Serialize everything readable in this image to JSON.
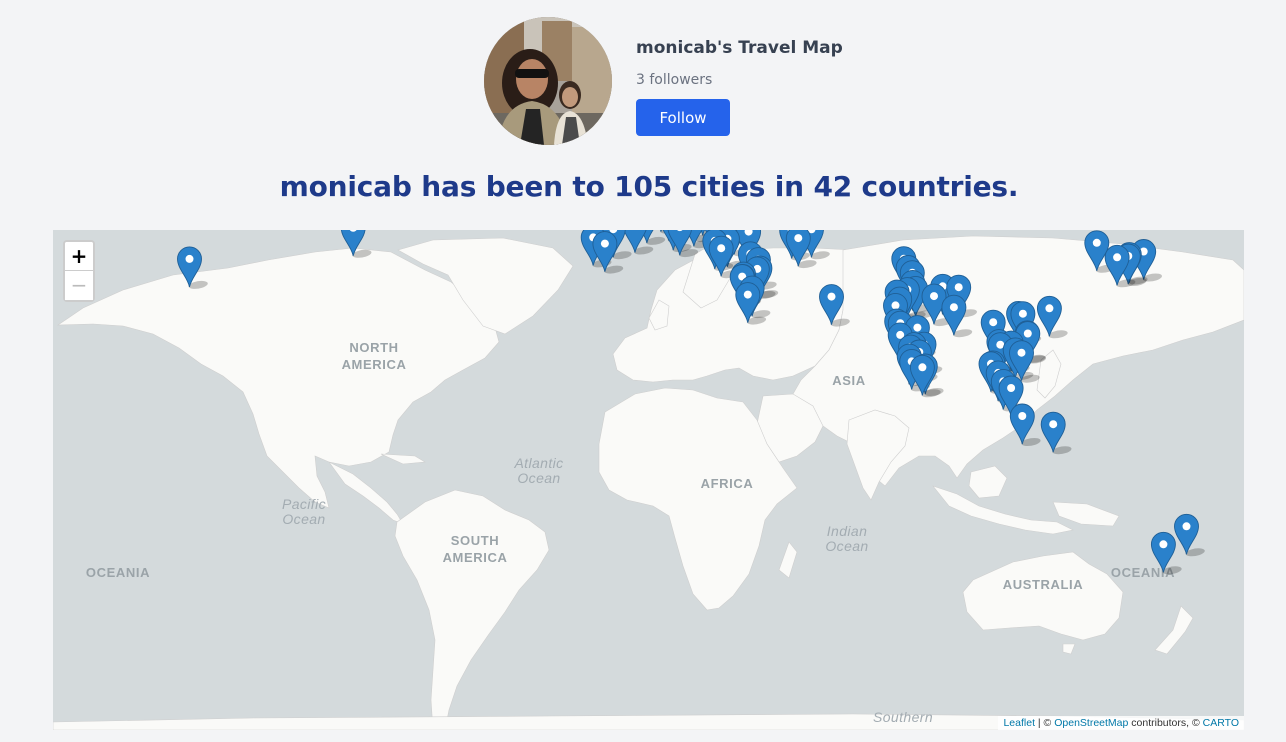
{
  "profile": {
    "title": "monicab's Travel Map",
    "followers": "3 followers",
    "follow_label": "Follow"
  },
  "headline": "monicab has been to 105 cities in 42 countries.",
  "map": {
    "zoom_in": "+",
    "zoom_out": "−",
    "labels": {
      "north_america": [
        "NORTH",
        "AMERICA"
      ],
      "south_america": [
        "SOUTH",
        "AMERICA"
      ],
      "africa": "AFRICA",
      "asia": "ASIA",
      "australia": "AUSTRALIA",
      "oceania_left": "OCEANIA",
      "oceania_right": "OCEANIA",
      "atlantic": [
        "Atlantic",
        "Ocean"
      ],
      "pacific": [
        "Pacific",
        "Ocean"
      ],
      "indian": [
        "Indian",
        "Ocean"
      ],
      "southern": "Southern"
    },
    "attribution": {
      "leaflet": "Leaflet",
      "sep": " | © ",
      "osm": "OpenStreetMap",
      "contrib": " contributors, © ",
      "carto": "CARTO"
    },
    "marker_color": "#2a81cb",
    "markers": [
      {
        "lat": 34.05,
        "lon": -118.24
      },
      {
        "lat": 40.71,
        "lon": -74.0
      },
      {
        "lat": 38.72,
        "lon": -9.14
      },
      {
        "lat": 40.42,
        "lon": -3.7
      },
      {
        "lat": 41.39,
        "lon": 2.17
      },
      {
        "lat": 37.39,
        "lon": -5.98
      },
      {
        "lat": 43.3,
        "lon": 5.37
      },
      {
        "lat": 48.86,
        "lon": 2.35
      },
      {
        "lat": 50.85,
        "lon": 4.35
      },
      {
        "lat": 51.51,
        "lon": -0.13
      },
      {
        "lat": 52.37,
        "lon": 4.9
      },
      {
        "lat": 53.35,
        "lon": -6.26
      },
      {
        "lat": 55.95,
        "lon": -3.19
      },
      {
        "lat": 52.52,
        "lon": 13.4
      },
      {
        "lat": 50.08,
        "lon": 14.44
      },
      {
        "lat": 48.21,
        "lon": 16.37
      },
      {
        "lat": 47.5,
        "lon": 19.04
      },
      {
        "lat": 48.14,
        "lon": 11.58
      },
      {
        "lat": 47.38,
        "lon": 8.54
      },
      {
        "lat": 45.46,
        "lon": 9.19
      },
      {
        "lat": 45.44,
        "lon": 12.32
      },
      {
        "lat": 43.77,
        "lon": 11.26
      },
      {
        "lat": 41.9,
        "lon": 12.5
      },
      {
        "lat": 40.85,
        "lon": 14.27
      },
      {
        "lat": 44.43,
        "lon": 26.1
      },
      {
        "lat": 42.7,
        "lon": 23.32
      },
      {
        "lat": 44.79,
        "lon": 20.45
      },
      {
        "lat": 43.86,
        "lon": 18.41
      },
      {
        "lat": 42.65,
        "lon": 18.09
      },
      {
        "lat": 41.01,
        "lon": 28.98
      },
      {
        "lat": 39.93,
        "lon": 32.86
      },
      {
        "lat": 38.42,
        "lon": 27.14
      },
      {
        "lat": 37.98,
        "lon": 23.73
      },
      {
        "lat": 36.4,
        "lon": 25.46
      },
      {
        "lat": 35.17,
        "lon": 33.36
      },
      {
        "lat": 33.89,
        "lon": 35.5
      },
      {
        "lat": 31.77,
        "lon": 35.21
      },
      {
        "lat": 31.95,
        "lon": 35.93
      },
      {
        "lat": 30.58,
        "lon": 31.5
      },
      {
        "lat": 30.04,
        "lon": 31.24
      },
      {
        "lat": 29.98,
        "lon": 31.13
      },
      {
        "lat": 27.26,
        "lon": 33.81
      },
      {
        "lat": 25.69,
        "lon": 32.64
      },
      {
        "lat": 41.72,
        "lon": 44.78
      },
      {
        "lat": 40.18,
        "lon": 44.51
      },
      {
        "lat": 40.41,
        "lon": 49.87
      },
      {
        "lat": 38.56,
        "lon": 46.3
      },
      {
        "lat": 25.2,
        "lon": 55.27
      },
      {
        "lat": 34.08,
        "lon": 74.8
      },
      {
        "lat": 32.1,
        "lon": 76.0
      },
      {
        "lat": 30.9,
        "lon": 77.1
      },
      {
        "lat": 28.61,
        "lon": 77.21
      },
      {
        "lat": 27.18,
        "lon": 78.01
      },
      {
        "lat": 26.91,
        "lon": 75.79
      },
      {
        "lat": 26.3,
        "lon": 73.0
      },
      {
        "lat": 24.58,
        "lon": 73.71
      },
      {
        "lat": 23.02,
        "lon": 72.57
      },
      {
        "lat": 25.32,
        "lon": 82.97
      },
      {
        "lat": 27.7,
        "lon": 85.32
      },
      {
        "lat": 27.47,
        "lon": 89.64
      },
      {
        "lat": 22.57,
        "lon": 88.36
      },
      {
        "lat": 19.08,
        "lon": 72.88
      },
      {
        "lat": 18.52,
        "lon": 73.86
      },
      {
        "lat": 17.39,
        "lon": 78.49
      },
      {
        "lat": 15.5,
        "lon": 73.83
      },
      {
        "lat": 12.97,
        "lon": 77.59
      },
      {
        "lat": 13.08,
        "lon": 80.27
      },
      {
        "lat": 12.3,
        "lon": 76.64
      },
      {
        "lat": 9.93,
        "lon": 76.26
      },
      {
        "lat": 8.52,
        "lon": 76.94
      },
      {
        "lat": 11.0,
        "lon": 79.0
      },
      {
        "lat": 6.93,
        "lon": 79.85
      },
      {
        "lat": 7.29,
        "lon": 80.63
      },
      {
        "lat": 21.03,
        "lon": 105.85
      },
      {
        "lat": 20.95,
        "lon": 107.0
      },
      {
        "lat": 22.3,
        "lon": 114.17
      },
      {
        "lat": 16.05,
        "lon": 108.2
      },
      {
        "lat": 15.88,
        "lon": 108.33
      },
      {
        "lat": 18.79,
        "lon": 98.98
      },
      {
        "lat": 13.76,
        "lon": 100.5
      },
      {
        "lat": 12.93,
        "lon": 100.88
      },
      {
        "lat": 13.36,
        "lon": 103.86
      },
      {
        "lat": 11.56,
        "lon": 104.92
      },
      {
        "lat": 10.82,
        "lon": 106.63
      },
      {
        "lat": 7.88,
        "lon": 98.39
      },
      {
        "lat": 8.1,
        "lon": 98.9
      },
      {
        "lat": 3.14,
        "lon": 101.69
      },
      {
        "lat": 5.42,
        "lon": 100.33
      },
      {
        "lat": 1.35,
        "lon": 103.82
      },
      {
        "lat": -6.2,
        "lon": 106.85
      },
      {
        "lat": -8.41,
        "lon": 115.19
      },
      {
        "lat": 35.68,
        "lon": 139.65
      },
      {
        "lat": 35.01,
        "lon": 135.77
      },
      {
        "lat": 34.69,
        "lon": 135.5
      },
      {
        "lat": 34.39,
        "lon": 132.46
      },
      {
        "lat": 37.57,
        "lon": 126.98
      },
      {
        "lat": -33.87,
        "lon": 151.21
      },
      {
        "lat": -37.81,
        "lon": 144.96
      }
    ]
  }
}
